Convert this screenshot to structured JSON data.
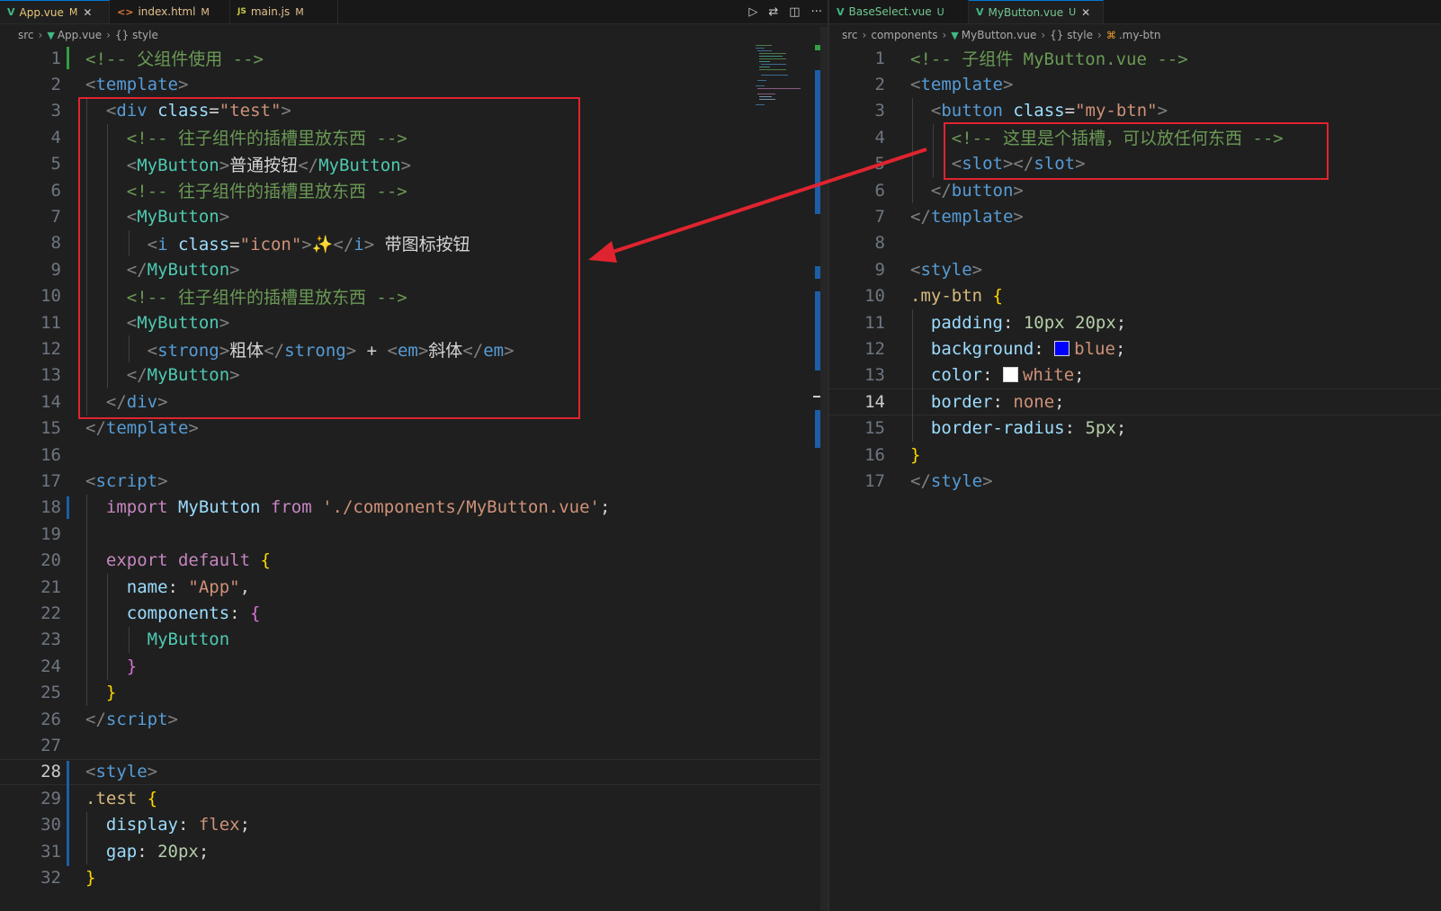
{
  "left": {
    "tabs": [
      {
        "icon": "V",
        "label": "App.vue",
        "status": "M",
        "close": "✕",
        "active": true
      },
      {
        "icon": "<>",
        "label": "index.html",
        "status": "M",
        "active": false
      },
      {
        "icon": "JS",
        "label": "main.js",
        "status": "M",
        "active": false
      }
    ],
    "breadcrumb": [
      "src",
      "App.vue",
      "{} style"
    ],
    "lines": [
      {
        "n": "1",
        "t": [
          [
            "<!-- 父组件使用 -->",
            "c-cm"
          ]
        ]
      },
      {
        "n": "2",
        "t": [
          [
            "<",
            "c-br"
          ],
          [
            "template",
            "c-tag"
          ],
          [
            ">",
            "c-br"
          ]
        ]
      },
      {
        "n": "3",
        "t": [
          [
            "  <",
            "c-br"
          ],
          [
            "div",
            "c-tag"
          ],
          [
            " class",
            "c-at"
          ],
          [
            "=",
            "c-txt"
          ],
          [
            "\"test\"",
            "c-str"
          ],
          [
            ">",
            "c-br"
          ]
        ]
      },
      {
        "n": "4",
        "t": [
          [
            "    <!-- 往子组件的插槽里放东西 -->",
            "c-cm"
          ]
        ]
      },
      {
        "n": "5",
        "t": [
          [
            "    <",
            "c-br"
          ],
          [
            "MyButton",
            "c-cmp"
          ],
          [
            ">",
            "c-br"
          ],
          [
            "普通按钮",
            "c-txt"
          ],
          [
            "</",
            "c-br"
          ],
          [
            "MyButton",
            "c-cmp"
          ],
          [
            ">",
            "c-br"
          ]
        ]
      },
      {
        "n": "6",
        "t": [
          [
            "    <!-- 往子组件的插槽里放东西 -->",
            "c-cm"
          ]
        ]
      },
      {
        "n": "7",
        "t": [
          [
            "    <",
            "c-br"
          ],
          [
            "MyButton",
            "c-cmp"
          ],
          [
            ">",
            "c-br"
          ]
        ]
      },
      {
        "n": "8",
        "t": [
          [
            "      <",
            "c-br"
          ],
          [
            "i",
            "c-tag"
          ],
          [
            " class",
            "c-at"
          ],
          [
            "=",
            "c-txt"
          ],
          [
            "\"icon\"",
            "c-str"
          ],
          [
            ">",
            "c-br"
          ],
          [
            "✨",
            "c-emoji"
          ],
          [
            "</",
            "c-br"
          ],
          [
            "i",
            "c-tag"
          ],
          [
            ">",
            "c-br"
          ],
          [
            " 带图标按钮",
            "c-txt"
          ]
        ]
      },
      {
        "n": "9",
        "t": [
          [
            "    </",
            "c-br"
          ],
          [
            "MyButton",
            "c-cmp"
          ],
          [
            ">",
            "c-br"
          ]
        ]
      },
      {
        "n": "10",
        "t": [
          [
            "    <!-- 往子组件的插槽里放东西 -->",
            "c-cm"
          ]
        ]
      },
      {
        "n": "11",
        "t": [
          [
            "    <",
            "c-br"
          ],
          [
            "MyButton",
            "c-cmp"
          ],
          [
            ">",
            "c-br"
          ]
        ]
      },
      {
        "n": "12",
        "t": [
          [
            "      <",
            "c-br"
          ],
          [
            "strong",
            "c-tag"
          ],
          [
            ">",
            "c-br"
          ],
          [
            "粗体",
            "c-txt"
          ],
          [
            "</",
            "c-br"
          ],
          [
            "strong",
            "c-tag"
          ],
          [
            ">",
            "c-br"
          ],
          [
            " + ",
            "c-txt"
          ],
          [
            "<",
            "c-br"
          ],
          [
            "em",
            "c-tag"
          ],
          [
            ">",
            "c-br"
          ],
          [
            "斜体",
            "c-txt"
          ],
          [
            "</",
            "c-br"
          ],
          [
            "em",
            "c-tag"
          ],
          [
            ">",
            "c-br"
          ]
        ]
      },
      {
        "n": "13",
        "t": [
          [
            "    </",
            "c-br"
          ],
          [
            "MyButton",
            "c-cmp"
          ],
          [
            ">",
            "c-br"
          ]
        ]
      },
      {
        "n": "14",
        "t": [
          [
            "  </",
            "c-br"
          ],
          [
            "div",
            "c-tag"
          ],
          [
            ">",
            "c-br"
          ]
        ]
      },
      {
        "n": "15",
        "t": [
          [
            "</",
            "c-br"
          ],
          [
            "template",
            "c-tag"
          ],
          [
            ">",
            "c-br"
          ]
        ]
      },
      {
        "n": "16",
        "t": []
      },
      {
        "n": "17",
        "t": [
          [
            "<",
            "c-br"
          ],
          [
            "script",
            "c-tag"
          ],
          [
            ">",
            "c-br"
          ]
        ]
      },
      {
        "n": "18",
        "t": [
          [
            "  import ",
            "c-kw"
          ],
          [
            "MyButton",
            "c-var"
          ],
          [
            " from ",
            "c-kw"
          ],
          [
            "'./components/MyButton.vue'",
            "c-str"
          ],
          [
            ";",
            "c-txt"
          ]
        ]
      },
      {
        "n": "19",
        "t": []
      },
      {
        "n": "20",
        "t": [
          [
            "  export default ",
            "c-kw"
          ],
          [
            "{",
            "c-p1"
          ]
        ]
      },
      {
        "n": "21",
        "t": [
          [
            "    name",
            "c-var"
          ],
          [
            ": ",
            "c-txt"
          ],
          [
            "\"App\"",
            "c-str"
          ],
          [
            ",",
            "c-txt"
          ]
        ]
      },
      {
        "n": "22",
        "t": [
          [
            "    components",
            "c-var"
          ],
          [
            ": ",
            "c-txt"
          ],
          [
            "{",
            "c-p2"
          ]
        ]
      },
      {
        "n": "23",
        "t": [
          [
            "      MyButton",
            "c-cmp"
          ]
        ]
      },
      {
        "n": "24",
        "t": [
          [
            "    }",
            "c-p2"
          ]
        ]
      },
      {
        "n": "25",
        "t": [
          [
            "  }",
            "c-p1"
          ]
        ]
      },
      {
        "n": "26",
        "t": [
          [
            "</",
            "c-br"
          ],
          [
            "script",
            "c-tag"
          ],
          [
            ">",
            "c-br"
          ]
        ]
      },
      {
        "n": "27",
        "t": []
      },
      {
        "n": "28",
        "t": [
          [
            "<",
            "c-br"
          ],
          [
            "style",
            "c-tag"
          ],
          [
            ">",
            "c-br"
          ]
        ],
        "current": true
      },
      {
        "n": "29",
        "t": [
          [
            ".test ",
            "c-sel"
          ],
          [
            "{",
            "c-p1"
          ]
        ]
      },
      {
        "n": "30",
        "t": [
          [
            "  display",
            "c-at"
          ],
          [
            ": ",
            "c-txt"
          ],
          [
            "flex",
            "c-val"
          ],
          [
            ";",
            "c-txt"
          ]
        ]
      },
      {
        "n": "31",
        "t": [
          [
            "  gap",
            "c-at"
          ],
          [
            ": ",
            "c-txt"
          ],
          [
            "20px",
            "c-num"
          ],
          [
            ";",
            "c-txt"
          ]
        ]
      },
      {
        "n": "32",
        "t": [
          [
            "}",
            "c-p1"
          ]
        ]
      }
    ]
  },
  "right": {
    "tabs": [
      {
        "icon": "V",
        "label": "BaseSelect.vue",
        "status": "U",
        "active": false
      },
      {
        "icon": "V",
        "label": "MyButton.vue",
        "status": "U",
        "close": "✕",
        "active": true
      }
    ],
    "breadcrumb": [
      "src",
      "components",
      "MyButton.vue",
      "{} style",
      ".my-btn"
    ],
    "lines": [
      {
        "n": "1",
        "t": [
          [
            "<!-- 子组件 MyButton.vue -->",
            "c-cm"
          ]
        ]
      },
      {
        "n": "2",
        "t": [
          [
            "<",
            "c-br"
          ],
          [
            "template",
            "c-tag"
          ],
          [
            ">",
            "c-br"
          ]
        ]
      },
      {
        "n": "3",
        "t": [
          [
            "  <",
            "c-br"
          ],
          [
            "button",
            "c-tag"
          ],
          [
            " class",
            "c-at"
          ],
          [
            "=",
            "c-txt"
          ],
          [
            "\"my-btn\"",
            "c-str"
          ],
          [
            ">",
            "c-br"
          ]
        ]
      },
      {
        "n": "4",
        "t": [
          [
            "    <!-- 这里是个插槽，可以放任何东西 -->",
            "c-cm"
          ]
        ]
      },
      {
        "n": "5",
        "t": [
          [
            "    <",
            "c-br"
          ],
          [
            "slot",
            "c-tag"
          ],
          [
            ">",
            "c-br"
          ],
          [
            "</",
            "c-br"
          ],
          [
            "slot",
            "c-tag"
          ],
          [
            ">",
            "c-br"
          ]
        ]
      },
      {
        "n": "6",
        "t": [
          [
            "  </",
            "c-br"
          ],
          [
            "button",
            "c-tag"
          ],
          [
            ">",
            "c-br"
          ]
        ]
      },
      {
        "n": "7",
        "t": [
          [
            "</",
            "c-br"
          ],
          [
            "template",
            "c-tag"
          ],
          [
            ">",
            "c-br"
          ]
        ]
      },
      {
        "n": "8",
        "t": []
      },
      {
        "n": "9",
        "t": [
          [
            "<",
            "c-br"
          ],
          [
            "style",
            "c-tag"
          ],
          [
            ">",
            "c-br"
          ]
        ]
      },
      {
        "n": "10",
        "t": [
          [
            ".my-btn ",
            "c-sel"
          ],
          [
            "{",
            "c-p1"
          ]
        ]
      },
      {
        "n": "11",
        "t": [
          [
            "  padding",
            "c-at"
          ],
          [
            ": ",
            "c-txt"
          ],
          [
            "10px 20px",
            "c-num"
          ],
          [
            ";",
            "c-txt"
          ]
        ]
      },
      {
        "n": "12",
        "t": [
          [
            "  background",
            "c-at"
          ],
          [
            ": ",
            "c-txt"
          ],
          [
            "SWATCH:#0000ff",
            ""
          ],
          [
            "blue",
            "c-val"
          ],
          [
            ";",
            "c-txt"
          ]
        ]
      },
      {
        "n": "13",
        "t": [
          [
            "  color",
            "c-at"
          ],
          [
            ": ",
            "c-txt"
          ],
          [
            "SWATCH:#ffffff",
            ""
          ],
          [
            "white",
            "c-val"
          ],
          [
            ";",
            "c-txt"
          ]
        ]
      },
      {
        "n": "14",
        "t": [
          [
            "  border",
            "c-at"
          ],
          [
            ": ",
            "c-txt"
          ],
          [
            "none",
            "c-val"
          ],
          [
            ";",
            "c-txt"
          ]
        ],
        "current": true
      },
      {
        "n": "15",
        "t": [
          [
            "  border-radius",
            "c-at"
          ],
          [
            ": ",
            "c-txt"
          ],
          [
            "5px",
            "c-num"
          ],
          [
            ";",
            "c-txt"
          ]
        ]
      },
      {
        "n": "16",
        "t": [
          [
            "}",
            "c-p1"
          ]
        ]
      },
      {
        "n": "17",
        "t": [
          [
            "</",
            "c-br"
          ],
          [
            "style",
            "c-tag"
          ],
          [
            ">",
            "c-br"
          ]
        ]
      }
    ]
  },
  "colors": {
    "accent": "#0078d4",
    "annotation": "#e0242f",
    "modified": "#e2c08d",
    "untracked": "#73c991"
  }
}
